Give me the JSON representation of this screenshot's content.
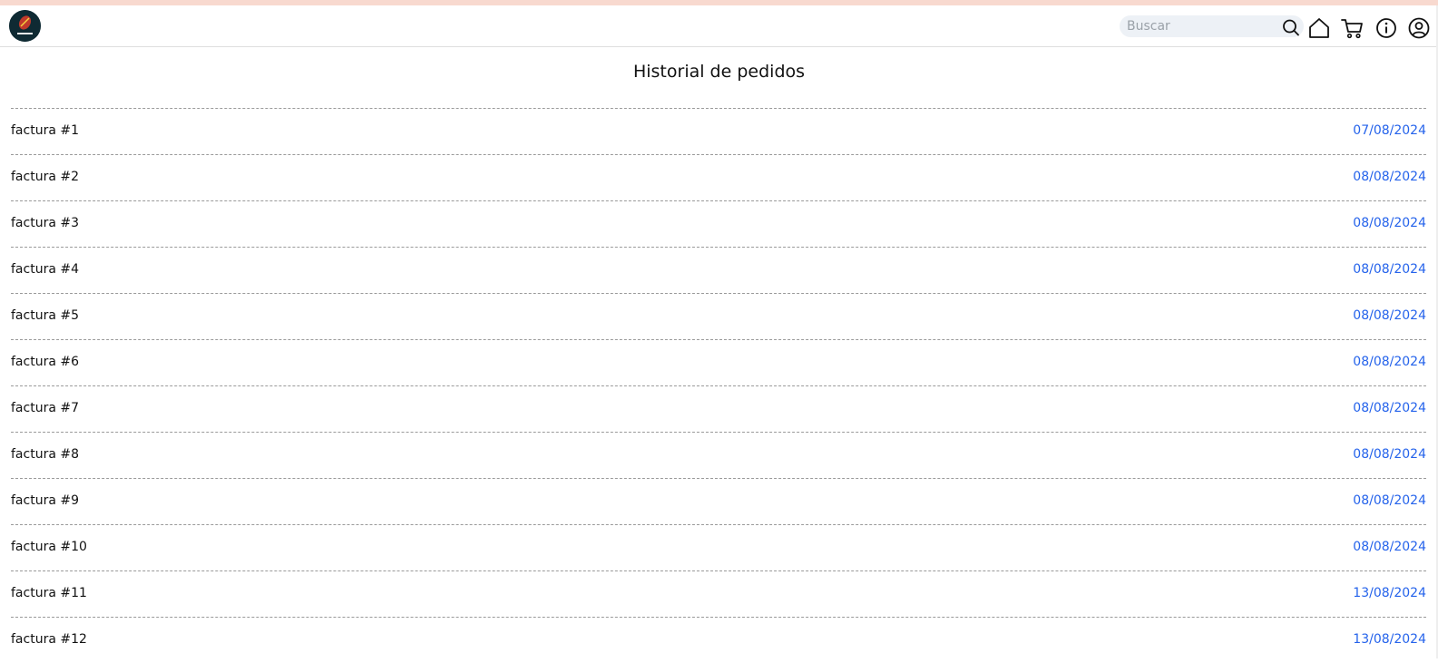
{
  "header": {
    "logo_icon": "brand-logo-icon",
    "search": {
      "placeholder": "Buscar",
      "value": "",
      "icon": "search-icon"
    },
    "nav_icons": [
      "home-icon",
      "cart-icon",
      "info-icon",
      "user-icon"
    ]
  },
  "page": {
    "title": "Historial de pedidos"
  },
  "orders": [
    {
      "label": "factura #1",
      "date": "07/08/2024"
    },
    {
      "label": "factura #2",
      "date": "08/08/2024"
    },
    {
      "label": "factura #3",
      "date": "08/08/2024"
    },
    {
      "label": "factura #4",
      "date": "08/08/2024"
    },
    {
      "label": "factura #5",
      "date": "08/08/2024"
    },
    {
      "label": "factura #6",
      "date": "08/08/2024"
    },
    {
      "label": "factura #7",
      "date": "08/08/2024"
    },
    {
      "label": "factura #8",
      "date": "08/08/2024"
    },
    {
      "label": "factura #9",
      "date": "08/08/2024"
    },
    {
      "label": "factura #10",
      "date": "08/08/2024"
    },
    {
      "label": "factura #11",
      "date": "13/08/2024"
    },
    {
      "label": "factura #12",
      "date": "13/08/2024"
    }
  ],
  "colors": {
    "date": "#2563eb",
    "top_strip": "#f8d9cf",
    "logo_bg": "#0f2a33"
  }
}
